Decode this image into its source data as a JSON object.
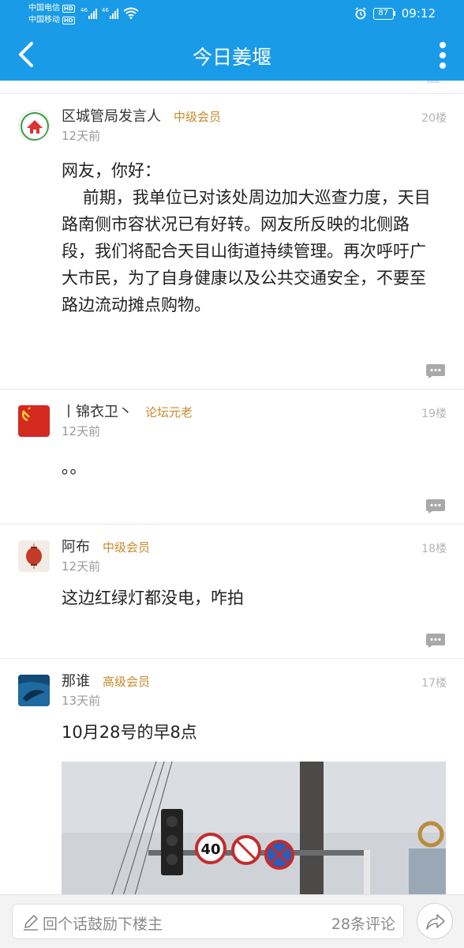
{
  "status_bar": {
    "carrier1": "中国电信",
    "carrier2": "中国移动",
    "hd_badge": "HD",
    "network1": "46",
    "network2": "46",
    "battery": "87",
    "time": "09:12"
  },
  "nav": {
    "title": "今日姜堰",
    "back_icon": "chevron-left-icon",
    "more_icon": "more-vertical-icon"
  },
  "posts": [
    {
      "author": "区城管局发言人",
      "level": "中级会员",
      "time": "12天前",
      "floor": "20楼",
      "content": "网友，你好：\n    前期，我单位已对该处周边加大巡查力度，天目路南侧市容状况已有好转。网友所反映的北侧路段，我们将配合天目山街道持续管理。再次呼吁广大市民，为了自身健康以及公共交通安全，不要至路边流动摊点购物。"
    },
    {
      "author": "丨锦衣卫丶",
      "level": "论坛元老",
      "time": "12天前",
      "floor": "19楼",
      "content": "。。"
    },
    {
      "author": "阿布",
      "level": "中级会员",
      "time": "12天前",
      "floor": "18楼",
      "content": "这边红绿灯都没电，咋拍"
    },
    {
      "author": "那谁",
      "level": "高级会员",
      "time": "13天前",
      "floor": "17楼",
      "content": "10月28号的早8点"
    }
  ],
  "bottom_bar": {
    "placeholder": "回个话鼓励下楼主",
    "comment_count": "28条评论",
    "pencil_icon": "pencil-icon",
    "share_icon": "share-icon"
  },
  "colors": {
    "primary": "#1a9be8",
    "level": "#c98a2a",
    "meta": "#999999"
  }
}
